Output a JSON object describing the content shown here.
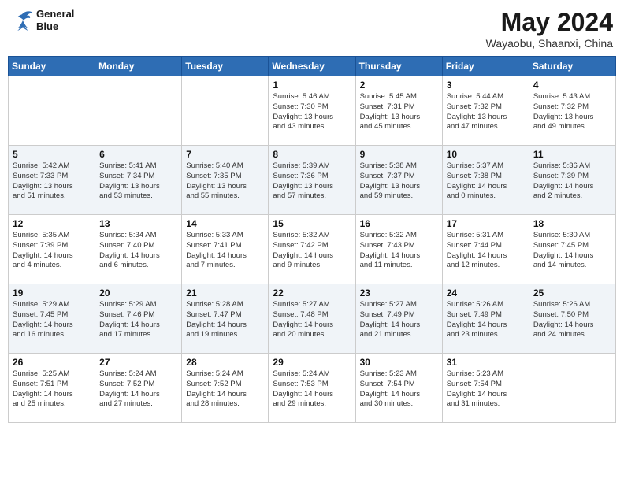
{
  "header": {
    "logo_line1": "General",
    "logo_line2": "Blue",
    "month_year": "May 2024",
    "location": "Wayaobu, Shaanxi, China"
  },
  "weekdays": [
    "Sunday",
    "Monday",
    "Tuesday",
    "Wednesday",
    "Thursday",
    "Friday",
    "Saturday"
  ],
  "weeks": [
    [
      {
        "day": "",
        "info": ""
      },
      {
        "day": "",
        "info": ""
      },
      {
        "day": "",
        "info": ""
      },
      {
        "day": "1",
        "info": "Sunrise: 5:46 AM\nSunset: 7:30 PM\nDaylight: 13 hours\nand 43 minutes."
      },
      {
        "day": "2",
        "info": "Sunrise: 5:45 AM\nSunset: 7:31 PM\nDaylight: 13 hours\nand 45 minutes."
      },
      {
        "day": "3",
        "info": "Sunrise: 5:44 AM\nSunset: 7:32 PM\nDaylight: 13 hours\nand 47 minutes."
      },
      {
        "day": "4",
        "info": "Sunrise: 5:43 AM\nSunset: 7:32 PM\nDaylight: 13 hours\nand 49 minutes."
      }
    ],
    [
      {
        "day": "5",
        "info": "Sunrise: 5:42 AM\nSunset: 7:33 PM\nDaylight: 13 hours\nand 51 minutes."
      },
      {
        "day": "6",
        "info": "Sunrise: 5:41 AM\nSunset: 7:34 PM\nDaylight: 13 hours\nand 53 minutes."
      },
      {
        "day": "7",
        "info": "Sunrise: 5:40 AM\nSunset: 7:35 PM\nDaylight: 13 hours\nand 55 minutes."
      },
      {
        "day": "8",
        "info": "Sunrise: 5:39 AM\nSunset: 7:36 PM\nDaylight: 13 hours\nand 57 minutes."
      },
      {
        "day": "9",
        "info": "Sunrise: 5:38 AM\nSunset: 7:37 PM\nDaylight: 13 hours\nand 59 minutes."
      },
      {
        "day": "10",
        "info": "Sunrise: 5:37 AM\nSunset: 7:38 PM\nDaylight: 14 hours\nand 0 minutes."
      },
      {
        "day": "11",
        "info": "Sunrise: 5:36 AM\nSunset: 7:39 PM\nDaylight: 14 hours\nand 2 minutes."
      }
    ],
    [
      {
        "day": "12",
        "info": "Sunrise: 5:35 AM\nSunset: 7:39 PM\nDaylight: 14 hours\nand 4 minutes."
      },
      {
        "day": "13",
        "info": "Sunrise: 5:34 AM\nSunset: 7:40 PM\nDaylight: 14 hours\nand 6 minutes."
      },
      {
        "day": "14",
        "info": "Sunrise: 5:33 AM\nSunset: 7:41 PM\nDaylight: 14 hours\nand 7 minutes."
      },
      {
        "day": "15",
        "info": "Sunrise: 5:32 AM\nSunset: 7:42 PM\nDaylight: 14 hours\nand 9 minutes."
      },
      {
        "day": "16",
        "info": "Sunrise: 5:32 AM\nSunset: 7:43 PM\nDaylight: 14 hours\nand 11 minutes."
      },
      {
        "day": "17",
        "info": "Sunrise: 5:31 AM\nSunset: 7:44 PM\nDaylight: 14 hours\nand 12 minutes."
      },
      {
        "day": "18",
        "info": "Sunrise: 5:30 AM\nSunset: 7:45 PM\nDaylight: 14 hours\nand 14 minutes."
      }
    ],
    [
      {
        "day": "19",
        "info": "Sunrise: 5:29 AM\nSunset: 7:45 PM\nDaylight: 14 hours\nand 16 minutes."
      },
      {
        "day": "20",
        "info": "Sunrise: 5:29 AM\nSunset: 7:46 PM\nDaylight: 14 hours\nand 17 minutes."
      },
      {
        "day": "21",
        "info": "Sunrise: 5:28 AM\nSunset: 7:47 PM\nDaylight: 14 hours\nand 19 minutes."
      },
      {
        "day": "22",
        "info": "Sunrise: 5:27 AM\nSunset: 7:48 PM\nDaylight: 14 hours\nand 20 minutes."
      },
      {
        "day": "23",
        "info": "Sunrise: 5:27 AM\nSunset: 7:49 PM\nDaylight: 14 hours\nand 21 minutes."
      },
      {
        "day": "24",
        "info": "Sunrise: 5:26 AM\nSunset: 7:49 PM\nDaylight: 14 hours\nand 23 minutes."
      },
      {
        "day": "25",
        "info": "Sunrise: 5:26 AM\nSunset: 7:50 PM\nDaylight: 14 hours\nand 24 minutes."
      }
    ],
    [
      {
        "day": "26",
        "info": "Sunrise: 5:25 AM\nSunset: 7:51 PM\nDaylight: 14 hours\nand 25 minutes."
      },
      {
        "day": "27",
        "info": "Sunrise: 5:24 AM\nSunset: 7:52 PM\nDaylight: 14 hours\nand 27 minutes."
      },
      {
        "day": "28",
        "info": "Sunrise: 5:24 AM\nSunset: 7:52 PM\nDaylight: 14 hours\nand 28 minutes."
      },
      {
        "day": "29",
        "info": "Sunrise: 5:24 AM\nSunset: 7:53 PM\nDaylight: 14 hours\nand 29 minutes."
      },
      {
        "day": "30",
        "info": "Sunrise: 5:23 AM\nSunset: 7:54 PM\nDaylight: 14 hours\nand 30 minutes."
      },
      {
        "day": "31",
        "info": "Sunrise: 5:23 AM\nSunset: 7:54 PM\nDaylight: 14 hours\nand 31 minutes."
      },
      {
        "day": "",
        "info": ""
      }
    ]
  ]
}
